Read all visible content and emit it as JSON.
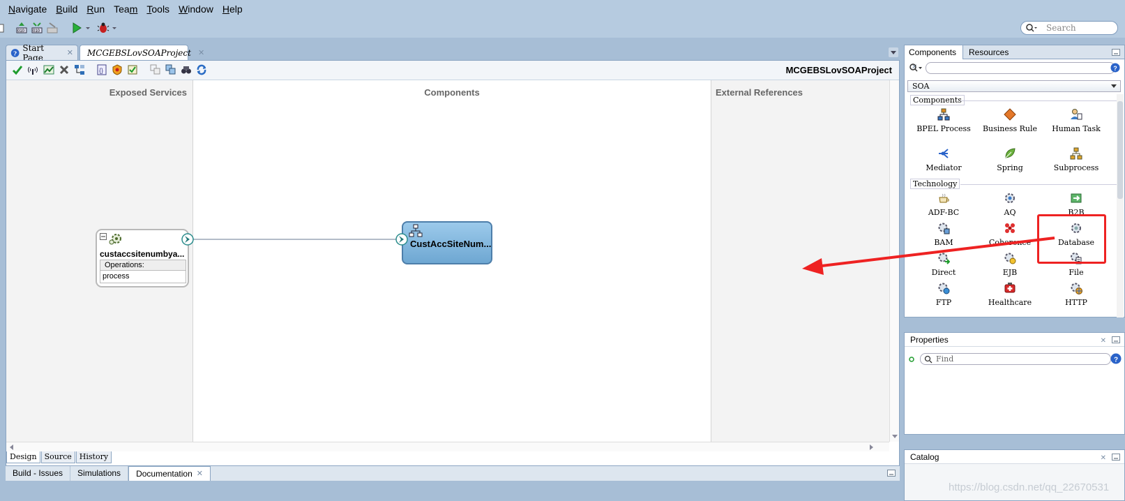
{
  "menu": [
    "Navigate",
    "Build",
    "Run",
    "Team",
    "Tools",
    "Window",
    "Help"
  ],
  "menu_underline": [
    "N",
    "B",
    "R",
    "m",
    "T",
    "W",
    "H"
  ],
  "toolbar": {
    "search_placeholder": "Search"
  },
  "editor_tabs": [
    {
      "label": "Start Page",
      "active": false
    },
    {
      "label": "MCGEBSLovSOAProject",
      "active": true
    }
  ],
  "editor": {
    "project_name": "MCGEBSLovSOAProject",
    "columns": {
      "exposed": "Exposed Services",
      "components": "Components",
      "external": "External References"
    },
    "service": {
      "title": "custaccsitenumbya...",
      "operations_label": "Operations:",
      "operation": "process"
    },
    "mediator": {
      "title": "CustAccSiteNum..."
    },
    "bottom_tabs": [
      "Design",
      "Source",
      "History"
    ]
  },
  "log_tabs": [
    "Build - Issues",
    "Simulations",
    "Documentation"
  ],
  "right_panel": {
    "tabs": [
      "Components",
      "Resources"
    ],
    "dropdown": "SOA",
    "sections": [
      {
        "title": "Components",
        "items": [
          "BPEL Process",
          "Business Rule",
          "Human Task",
          "Mediator",
          "Spring",
          "Subprocess"
        ]
      },
      {
        "title": "Technology",
        "items": [
          "ADF-BC",
          "AQ",
          "B2B",
          "BAM",
          "Coherence",
          "Database",
          "Direct",
          "EJB",
          "File",
          "FTP",
          "Healthcare",
          "HTTP"
        ]
      }
    ]
  },
  "properties": {
    "title": "Properties",
    "find_placeholder": "Find"
  },
  "catalog": {
    "title": "Catalog"
  },
  "watermark": "https://blog.csdn.net/qq_22670531",
  "colors": {
    "highlight": "#ee2222",
    "mediator_fill": "#7db4dc",
    "accent": "#2a8c8c"
  }
}
